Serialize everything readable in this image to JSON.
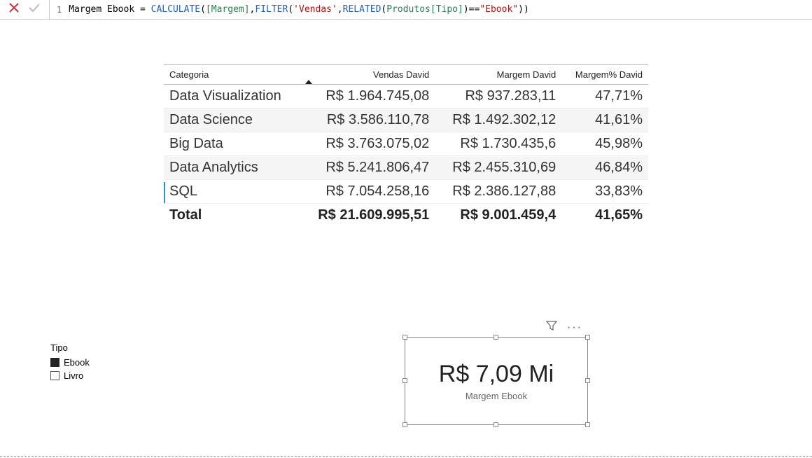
{
  "formula": {
    "line_number": "1",
    "measure_name": "Margem Ebook",
    "equals": " = ",
    "fn_calculate": "CALCULATE",
    "open1": "(",
    "arg_margem": "[Margem]",
    "comma1": ",",
    "fn_filter": "FILTER",
    "open2": "(",
    "arg_vendas": "'Vendas'",
    "comma2": ",",
    "fn_related": "RELATED",
    "open3": "(",
    "arg_produtos_tipo": "Produtos[Tipo]",
    "close3": ")",
    "eqeq": "==",
    "str_ebook": "\"Ebook\"",
    "close2": ")",
    "close1": ")"
  },
  "table": {
    "headers": {
      "categoria": "Categoria",
      "vendas": "Vendas David",
      "margem": "Margem David",
      "margem_pct": "Margem% David"
    },
    "rows": [
      {
        "categoria": "Data Visualization",
        "vendas": "R$ 1.964.745,08",
        "margem": "R$ 937.283,11",
        "pct": "47,71%"
      },
      {
        "categoria": "Data Science",
        "vendas": "R$ 3.586.110,78",
        "margem": "R$ 1.492.302,12",
        "pct": "41,61%"
      },
      {
        "categoria": "Big Data",
        "vendas": "R$ 3.763.075,02",
        "margem": "R$ 1.730.435,6",
        "pct": "45,98%"
      },
      {
        "categoria": "Data Analytics",
        "vendas": "R$ 5.241.806,47",
        "margem": "R$ 2.455.310,69",
        "pct": "46,84%"
      },
      {
        "categoria": "SQL",
        "vendas": "R$ 7.054.258,16",
        "margem": "R$ 2.386.127,88",
        "pct": "33,83%"
      }
    ],
    "total": {
      "label": "Total",
      "vendas": "R$ 21.609.995,51",
      "margem": "R$ 9.001.459,4",
      "pct": "41,65%"
    }
  },
  "slicer": {
    "title": "Tipo",
    "items": [
      {
        "label": "Ebook",
        "checked": true
      },
      {
        "label": "Livro",
        "checked": false
      }
    ]
  },
  "card": {
    "value": "R$ 7,09 Mi",
    "label": "Margem Ebook"
  }
}
